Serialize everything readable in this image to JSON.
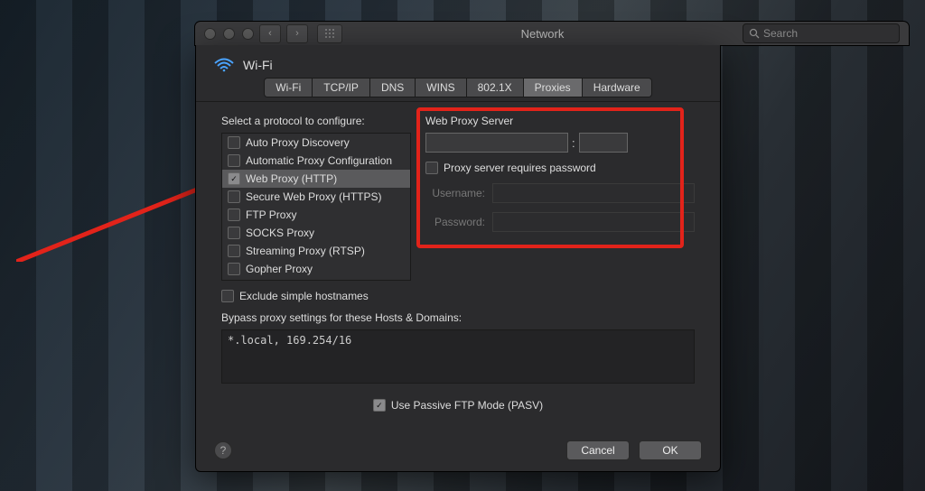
{
  "toolbar": {
    "title": "Network",
    "search_placeholder": "Search"
  },
  "header": {
    "title": "Wi-Fi"
  },
  "tabs": [
    "Wi-Fi",
    "TCP/IP",
    "DNS",
    "WINS",
    "802.1X",
    "Proxies",
    "Hardware"
  ],
  "active_tab": "Proxies",
  "left": {
    "label": "Select a protocol to configure:",
    "items": [
      {
        "label": "Auto Proxy Discovery",
        "checked": false
      },
      {
        "label": "Automatic Proxy Configuration",
        "checked": false
      },
      {
        "label": "Web Proxy (HTTP)",
        "checked": true,
        "selected": true
      },
      {
        "label": "Secure Web Proxy (HTTPS)",
        "checked": false
      },
      {
        "label": "FTP Proxy",
        "checked": false
      },
      {
        "label": "SOCKS Proxy",
        "checked": false
      },
      {
        "label": "Streaming Proxy (RTSP)",
        "checked": false
      },
      {
        "label": "Gopher Proxy",
        "checked": false
      }
    ]
  },
  "right": {
    "heading": "Web Proxy Server",
    "host": "",
    "port": "",
    "requires_password_label": "Proxy server requires password",
    "requires_password": false,
    "username_label": "Username:",
    "password_label": "Password:"
  },
  "exclude": {
    "label": "Exclude simple hostnames",
    "checked": false
  },
  "bypass": {
    "label": "Bypass proxy settings for these Hosts & Domains:",
    "value": "*.local, 169.254/16"
  },
  "pasv": {
    "label": "Use Passive FTP Mode (PASV)",
    "checked": true
  },
  "footer": {
    "cancel": "Cancel",
    "ok": "OK"
  }
}
